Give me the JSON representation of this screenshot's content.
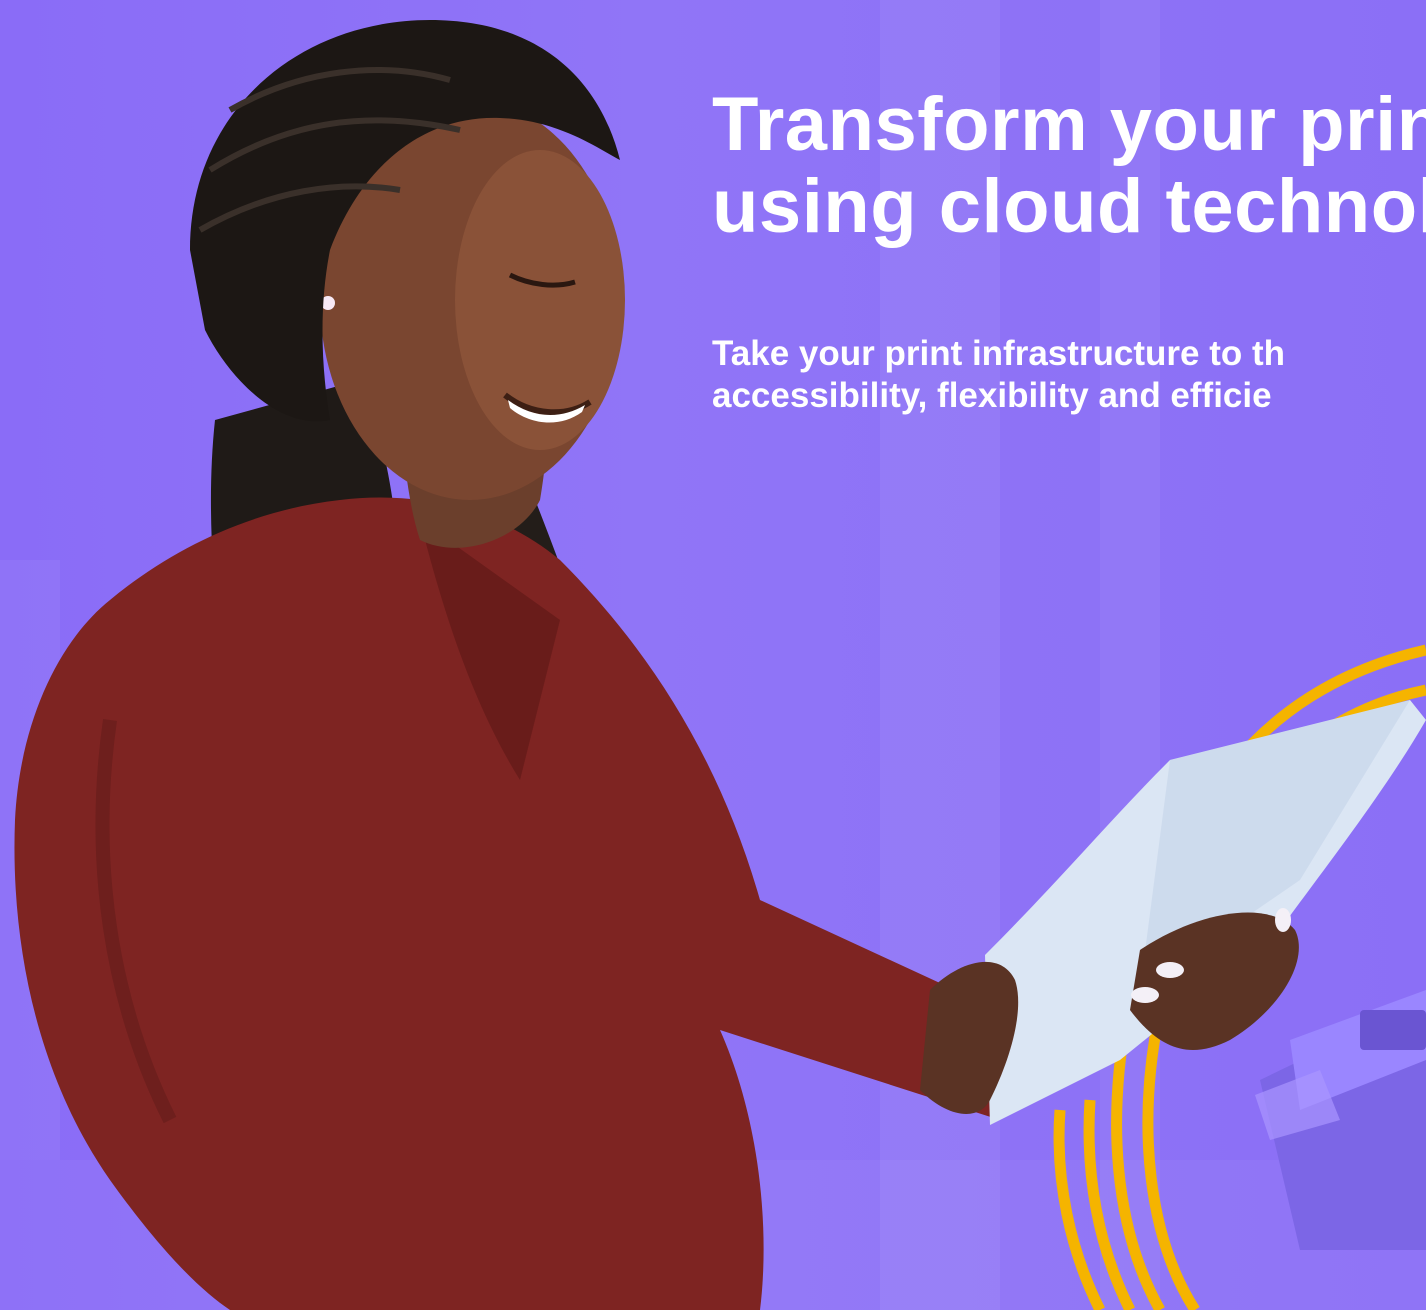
{
  "hero": {
    "headline_line1": "Transform your print",
    "headline_line2": "using cloud technol",
    "subhead_line1": "Take your print infrastructure to th",
    "subhead_line2": "accessibility, flexibility and efficie"
  },
  "colors": {
    "background": "#8b6ff6",
    "text": "#ffffff",
    "accent_rings": "#f5b400",
    "blouse": "#7e2422"
  },
  "image": {
    "subject": "woman-reading-document",
    "props": [
      "paper-sheet",
      "printer",
      "yellow-ring-graphic"
    ]
  }
}
